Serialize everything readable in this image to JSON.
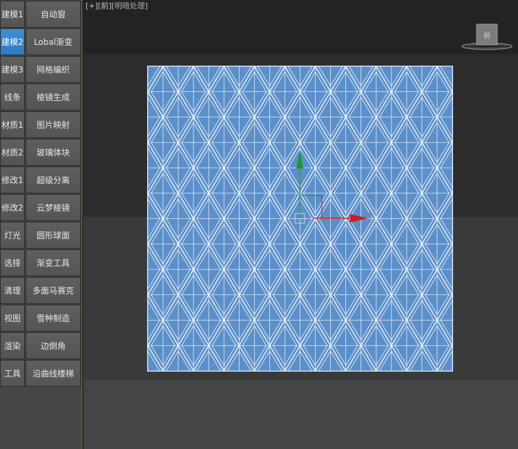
{
  "viewport": {
    "label_plus": "+",
    "label_view": "前",
    "label_shading": "明暗处理",
    "viewcube_label": "前"
  },
  "toolbar": {
    "rows": [
      {
        "category": "建模1",
        "tool": "自动窗"
      },
      {
        "category": "建模2",
        "tool": "Lobal渐变",
        "active": true
      },
      {
        "category": "建模3",
        "tool": "网格编织"
      },
      {
        "category": "线条",
        "tool": "棱镜生成"
      },
      {
        "category": "材质1",
        "tool": "图片映射"
      },
      {
        "category": "材质2",
        "tool": "玻璃体块"
      },
      {
        "category": "修改1",
        "tool": "超级分离"
      },
      {
        "category": "修改2",
        "tool": "云梦棱镜"
      },
      {
        "category": "灯光",
        "tool": "圆形球面"
      },
      {
        "category": "选择",
        "tool": "渐变工具"
      },
      {
        "category": "清理",
        "tool": "多面马赛克"
      },
      {
        "category": "视图",
        "tool": "雪种制造"
      },
      {
        "category": "渲染",
        "tool": "边倒角"
      },
      {
        "category": "工具",
        "tool": "沿曲线楼梯"
      }
    ]
  },
  "gizmo": {
    "x_axis_label": "x"
  },
  "colors": {
    "active_button": "#3a88d0",
    "pattern_fill": "#5b8fc9",
    "pattern_line": "#e6eef8",
    "gizmo_x": "#cc1f1f",
    "gizmo_y": "#1a9a2a"
  }
}
